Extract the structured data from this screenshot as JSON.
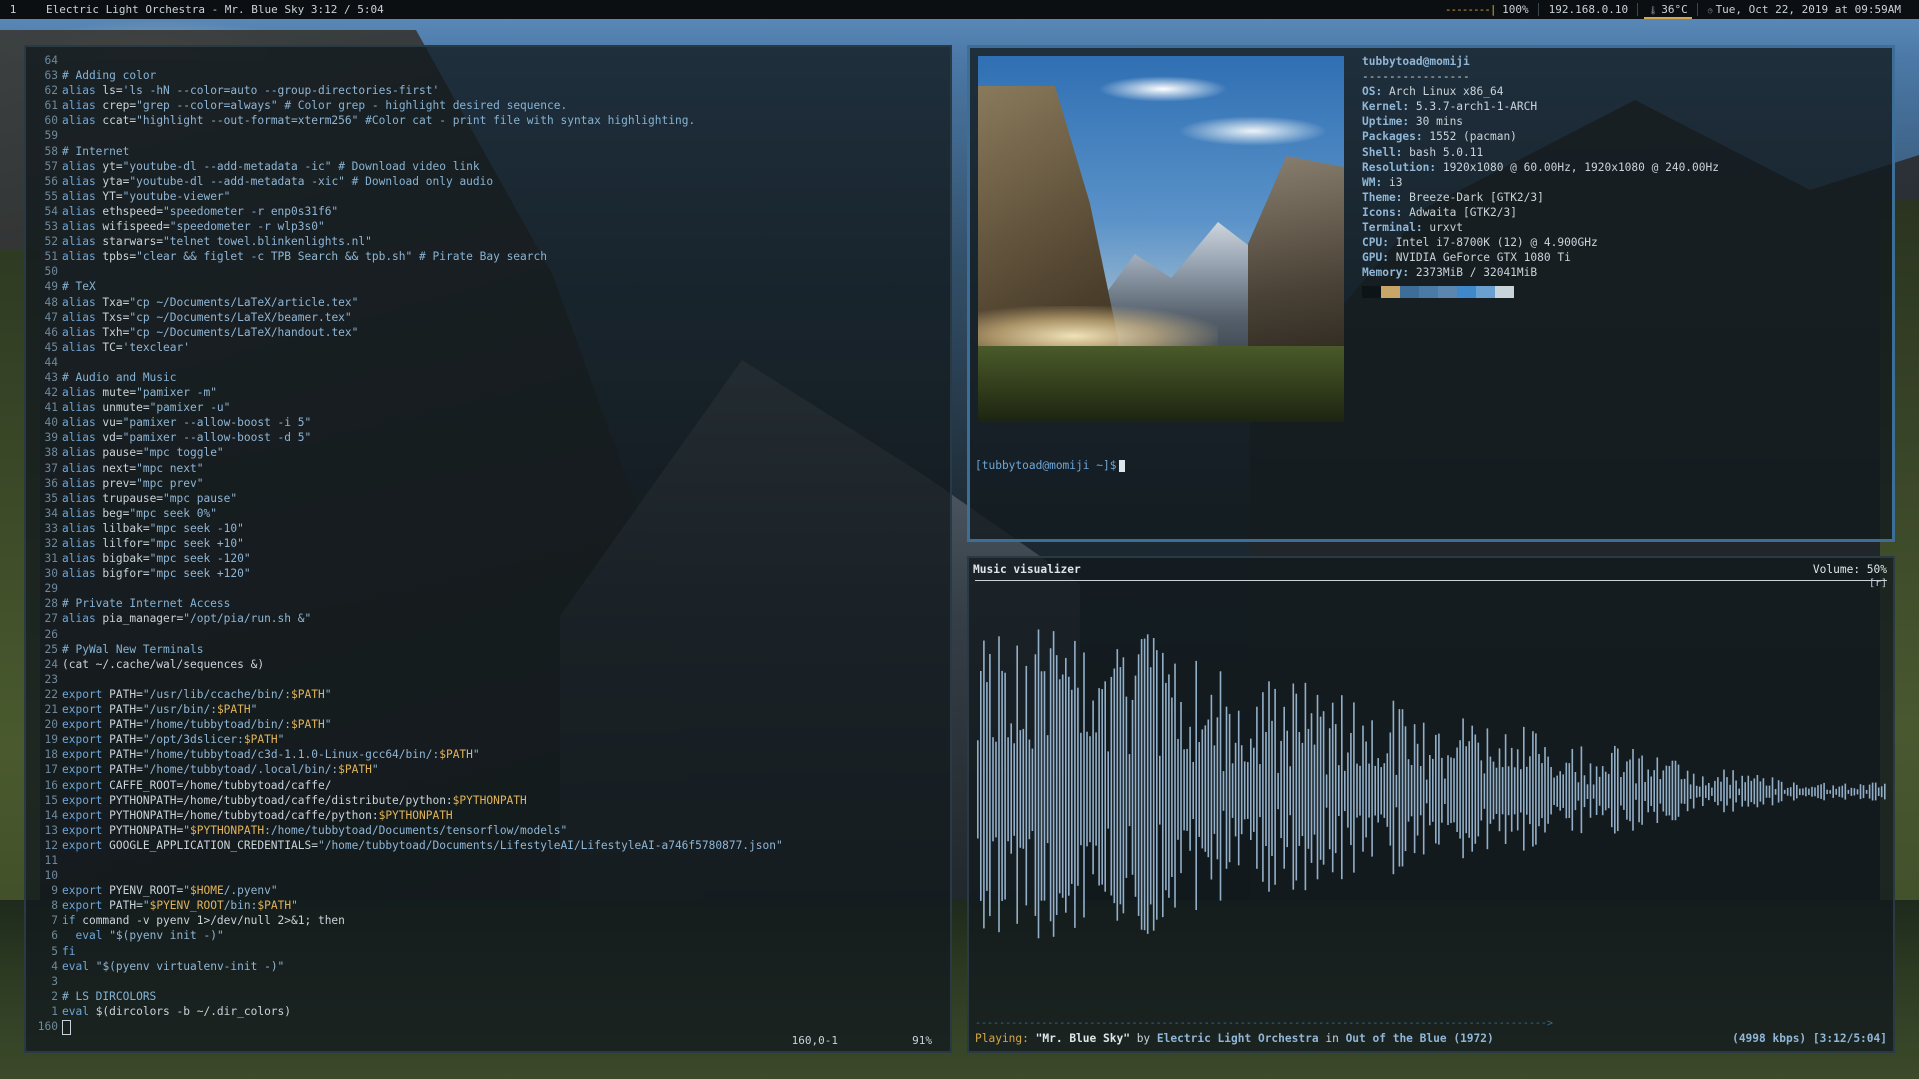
{
  "topbar": {
    "workspace": "1",
    "now_playing": "Electric Light Orchestra - Mr. Blue Sky 3:12 / 5:04",
    "battery_bar": "--------|",
    "battery_pct": "100%",
    "ip": "192.168.0.10",
    "temp": "36°C",
    "datetime": "Tue, Oct 22, 2019  at 09:59AM",
    "accent": "#d7a54a"
  },
  "vim": {
    "lines": [
      {
        "n": "64",
        "t": ""
      },
      {
        "n": "63",
        "t": "# Adding color",
        "c": "cm"
      },
      {
        "n": "62",
        "t": "alias ls='ls -hN --color=auto --group-directories-first'"
      },
      {
        "n": "61",
        "t": "alias crep=\"grep --color=always\" # Color grep - highlight desired sequence."
      },
      {
        "n": "60",
        "t": "alias ccat=\"highlight --out-format=xterm256\" #Color cat - print file with syntax highlighting."
      },
      {
        "n": "59",
        "t": ""
      },
      {
        "n": "58",
        "t": "# Internet",
        "c": "cm"
      },
      {
        "n": "57",
        "t": "alias yt=\"youtube-dl --add-metadata -ic\" # Download video link"
      },
      {
        "n": "56",
        "t": "alias yta=\"youtube-dl --add-metadata -xic\" # Download only audio"
      },
      {
        "n": "55",
        "t": "alias YT=\"youtube-viewer\""
      },
      {
        "n": "54",
        "t": "alias ethspeed=\"speedometer -r enp0s31f6\""
      },
      {
        "n": "53",
        "t": "alias wifispeed=\"speedometer -r wlp3s0\""
      },
      {
        "n": "52",
        "t": "alias starwars=\"telnet towel.blinkenlights.nl\""
      },
      {
        "n": "51",
        "t": "alias tpbs=\"clear && figlet -c TPB Search && tpb.sh\" # Pirate Bay search"
      },
      {
        "n": "50",
        "t": ""
      },
      {
        "n": "49",
        "t": "# TeX",
        "c": "cm"
      },
      {
        "n": "48",
        "t": "alias Txa=\"cp ~/Documents/LaTeX/article.tex\""
      },
      {
        "n": "47",
        "t": "alias Txs=\"cp ~/Documents/LaTeX/beamer.tex\""
      },
      {
        "n": "46",
        "t": "alias Txh=\"cp ~/Documents/LaTeX/handout.tex\""
      },
      {
        "n": "45",
        "t": "alias TC='texclear'"
      },
      {
        "n": "44",
        "t": ""
      },
      {
        "n": "43",
        "t": "# Audio and Music",
        "c": "cm"
      },
      {
        "n": "42",
        "t": "alias mute=\"pamixer -m\""
      },
      {
        "n": "41",
        "t": "alias unmute=\"pamixer -u\""
      },
      {
        "n": "40",
        "t": "alias vu=\"pamixer --allow-boost -i 5\""
      },
      {
        "n": "39",
        "t": "alias vd=\"pamixer --allow-boost -d 5\""
      },
      {
        "n": "38",
        "t": "alias pause=\"mpc toggle\""
      },
      {
        "n": "37",
        "t": "alias next=\"mpc next\""
      },
      {
        "n": "36",
        "t": "alias prev=\"mpc prev\""
      },
      {
        "n": "35",
        "t": "alias trupause=\"mpc pause\""
      },
      {
        "n": "34",
        "t": "alias beg=\"mpc seek 0%\""
      },
      {
        "n": "33",
        "t": "alias lilbak=\"mpc seek -10\""
      },
      {
        "n": "32",
        "t": "alias lilfor=\"mpc seek +10\""
      },
      {
        "n": "31",
        "t": "alias bigbak=\"mpc seek -120\""
      },
      {
        "n": "30",
        "t": "alias bigfor=\"mpc seek +120\""
      },
      {
        "n": "29",
        "t": ""
      },
      {
        "n": "28",
        "t": "# Private Internet Access",
        "c": "cm"
      },
      {
        "n": "27",
        "t": "alias pia_manager=\"/opt/pia/run.sh &\""
      },
      {
        "n": "26",
        "t": ""
      },
      {
        "n": "25",
        "t": "# PyWal New Terminals",
        "c": "cm"
      },
      {
        "n": "24",
        "t": "(cat ~/.cache/wal/sequences &)"
      },
      {
        "n": "23",
        "t": ""
      },
      {
        "n": "22",
        "t": "export PATH=\"/usr/lib/ccache/bin/:$PATH\""
      },
      {
        "n": "21",
        "t": "export PATH=\"/usr/bin/:$PATH\""
      },
      {
        "n": "20",
        "t": "export PATH=\"/home/tubbytoad/bin/:$PATH\""
      },
      {
        "n": "19",
        "t": "export PATH=\"/opt/3dslicer:$PATH\""
      },
      {
        "n": "18",
        "t": "export PATH=\"/home/tubbytoad/c3d-1.1.0-Linux-gcc64/bin/:$PATH\""
      },
      {
        "n": "17",
        "t": "export PATH=\"/home/tubbytoad/.local/bin/:$PATH\""
      },
      {
        "n": "16",
        "t": "export CAFFE_ROOT=/home/tubbytoad/caffe/"
      },
      {
        "n": "15",
        "t": "export PYTHONPATH=/home/tubbytoad/caffe/distribute/python:$PYTHONPATH"
      },
      {
        "n": "14",
        "t": "export PYTHONPATH=/home/tubbytoad/caffe/python:$PYTHONPATH"
      },
      {
        "n": "13",
        "t": "export PYTHONPATH=\"$PYTHONPATH:/home/tubbytoad/Documents/tensorflow/models\""
      },
      {
        "n": "12",
        "t": "export GOOGLE_APPLICATION_CREDENTIALS=\"/home/tubbytoad/Documents/LifestyleAI/LifestyleAI-a746f5780877.json\""
      },
      {
        "n": "11",
        "t": ""
      },
      {
        "n": "10",
        "t": ""
      },
      {
        "n": "9",
        "t": "export PYENV_ROOT=\"$HOME/.pyenv\""
      },
      {
        "n": "8",
        "t": "export PATH=\"$PYENV_ROOT/bin:$PATH\""
      },
      {
        "n": "7",
        "t": "if command -v pyenv 1>/dev/null 2>&1; then"
      },
      {
        "n": "6",
        "t": "  eval \"$(pyenv init -)\""
      },
      {
        "n": "5",
        "t": "fi"
      },
      {
        "n": "4",
        "t": "eval \"$(pyenv virtualenv-init -)\""
      },
      {
        "n": "3",
        "t": ""
      },
      {
        "n": "2",
        "t": "# LS DIRCOLORS",
        "c": "cm"
      },
      {
        "n": "1",
        "t": "eval $(dircolors -b ~/.dir_colors)"
      },
      {
        "n": "160",
        "t": "",
        "cursor": true
      }
    ],
    "position": "160,0-1",
    "percent": "91%"
  },
  "fetch": {
    "header": "tubbytoad@momiji",
    "underline": "----------------",
    "info": [
      {
        "k": "OS",
        "v": "Arch Linux x86_64"
      },
      {
        "k": "Kernel",
        "v": "5.3.7-arch1-1-ARCH"
      },
      {
        "k": "Uptime",
        "v": "30 mins"
      },
      {
        "k": "Packages",
        "v": "1552 (pacman)"
      },
      {
        "k": "Shell",
        "v": "bash 5.0.11"
      },
      {
        "k": "Resolution",
        "v": "1920x1080 @ 60.00Hz, 1920x1080 @ 240.00Hz"
      },
      {
        "k": "WM",
        "v": "i3"
      },
      {
        "k": "Theme",
        "v": "Breeze-Dark [GTK2/3]"
      },
      {
        "k": "Icons",
        "v": "Adwaita [GTK2/3]"
      },
      {
        "k": "Terminal",
        "v": "urxvt"
      },
      {
        "k": "CPU",
        "v": "Intel i7-8700K (12) @ 4.900GHz"
      },
      {
        "k": "GPU",
        "v": "NVIDIA GeForce GTX 1080 Ti"
      },
      {
        "k": "Memory",
        "v": "2373MiB / 32041MiB"
      }
    ],
    "palette": [
      "#0d1418",
      "#c9a56a",
      "#3c6e97",
      "#4a7aa6",
      "#5a86b0",
      "#3f88c9",
      "#6aa0cf",
      "#c9d3da"
    ],
    "prompt_user": "[tubbytoad@momiji ~]$"
  },
  "cava": {
    "title": "Music visualizer",
    "volume": "Volume: 50%",
    "repeat_flag": "[r]",
    "status_label": "Playing:",
    "song": "\"Mr. Blue Sky\"",
    "by": "by",
    "artist": "Electric Light Orchestra",
    "in": "in",
    "album": "Out of the Blue (1972)",
    "rate": "(4998 kbps) [3:12/5:04]",
    "progress_fraction": 0.63,
    "bar_color": "#a9c9e6"
  }
}
